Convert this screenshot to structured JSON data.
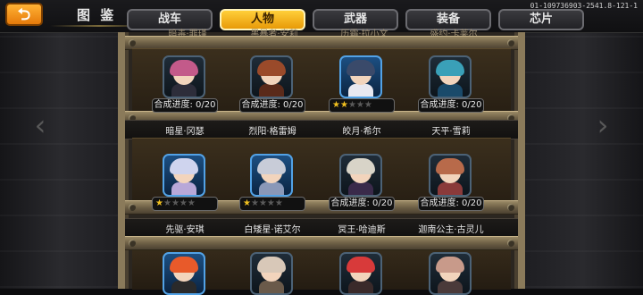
{
  "header": {
    "back_label": "⮌",
    "title": "图 鉴",
    "build_id": "01-109736903-2541.8-121-1"
  },
  "tabs": [
    {
      "label": "战车",
      "active": false
    },
    {
      "label": "人物",
      "active": true
    },
    {
      "label": "武器",
      "active": false
    },
    {
      "label": "装备",
      "active": false
    },
    {
      "label": "芯片",
      "active": false
    }
  ],
  "top_row_names_cut": [
    "暗毒·罪瑾",
    "黑暴者·安莉",
    "历霜·拉小文",
    "盛约·卡莱尔"
  ],
  "rows": [
    {
      "cards": [
        {
          "status": "progress",
          "progress_label": "合成进度: 0/20",
          "progress": 0,
          "hair": "#c35a8a",
          "body": "#2d2d3a",
          "rarity": "r-gray"
        },
        {
          "status": "progress",
          "progress_label": "合成进度: 0/20",
          "progress": 0,
          "hair": "#9a4a2a",
          "body": "#5a2a1a",
          "rarity": "r-gray"
        },
        {
          "status": "stars",
          "stars": "★★★★★",
          "filled": 2,
          "hair": "#3a4a6a",
          "body": "#e8e8f0",
          "rarity": "r-blue2"
        },
        {
          "status": "progress",
          "progress_label": "合成进度: 0/20",
          "progress": 0,
          "hair": "#3aa0b8",
          "body": "#1a4a6a",
          "rarity": "r-gray"
        }
      ],
      "names": [
        "暗星·冈瑟",
        "烈阳·格雷姆",
        "皎月·希尔",
        "天平·雪莉"
      ]
    },
    {
      "cards": [
        {
          "status": "stars",
          "stars": "★★★★★",
          "filled": 1,
          "hair": "#cfd4ee",
          "body": "#b8a8d8",
          "rarity": "r-blue2"
        },
        {
          "status": "stars",
          "stars": "★★★★★",
          "filled": 1,
          "hair": "#c8ccd8",
          "body": "#8a98b8",
          "rarity": "r-blue2"
        },
        {
          "status": "progress",
          "progress_label": "合成进度: 0/20",
          "progress": 0,
          "hair": "#d8d4c8",
          "body": "#3a2a4a",
          "rarity": "r-gray"
        },
        {
          "status": "progress",
          "progress_label": "合成进度: 0/20",
          "progress": 0,
          "hair": "#b86a4a",
          "body": "#8a3a3a",
          "rarity": "r-gray"
        }
      ],
      "names": [
        "先驱·安琪",
        "白矮星·诺艾尔",
        "冥王·哈迪斯",
        "迦南公主·古灵儿"
      ]
    },
    {
      "cards": [
        {
          "hair": "#e85a2a",
          "body": "#2a2a2a",
          "rarity": "r-blue2"
        },
        {
          "hair": "#d8c8b8",
          "body": "#6a5a4a",
          "rarity": "r-gray"
        },
        {
          "hair": "#d83a3a",
          "body": "#3a2a2a",
          "rarity": "r-gray"
        },
        {
          "hair": "#c89a8a",
          "body": "#4a3a3a",
          "rarity": "r-gray"
        }
      ]
    }
  ],
  "colors": {
    "accent": "#f2a21a",
    "tab_active": "#ffcf3a",
    "frame": "#8a7a5a"
  }
}
